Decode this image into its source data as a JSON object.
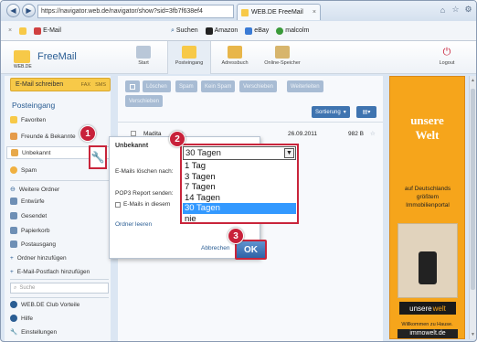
{
  "browser": {
    "url": "https://navigator.web.de/navigator/show?sid=3fb7f638ef4",
    "tab_title": "WEB.DE FreeMail",
    "toolbar": {
      "email_label": "E-Mail",
      "search_label": "Suchen",
      "amazon_label": "Amazon",
      "ebay_label": "eBay",
      "user_label": "malcolm"
    }
  },
  "app": {
    "brand": "WEB.DE",
    "product": "FreeMail",
    "nav": [
      "Start",
      "Posteingang",
      "Adressbuch",
      "Online-Speicher"
    ],
    "logout": "Logout"
  },
  "sidebar": {
    "compose": "E-Mail schreiben",
    "fax": "FAX",
    "sms": "SMS",
    "heading": "Posteingang",
    "items": [
      "Favoriten",
      "Freunde & Bekannte",
      "Unbekannt",
      "Spam",
      "Weitere Ordner",
      "Entwürfe",
      "Gesendet",
      "Papierkorb",
      "Postausgang",
      "Ordner hinzufügen",
      "E-Mail-Postfach hinzufügen"
    ],
    "search_placeholder": "Suche",
    "bottom": [
      "WEB.DE Club Vorteile",
      "Hilfe",
      "Einstellungen"
    ]
  },
  "main": {
    "toolbar": [
      "Löschen",
      "Spam",
      "Kein Spam",
      "Verschieben",
      "Weiterleiten"
    ],
    "toolbar_row2": "Verschieben",
    "sort": "Sortierung",
    "mail": {
      "sender": "Madita",
      "subject": "sie",
      "date": "26.09.2011",
      "size": "982 B"
    }
  },
  "dialog": {
    "title": "Unbekannt",
    "delete_label": "E-Mails löschen nach:",
    "pop3_label": "POP3 Report senden:",
    "checkbox_label": "E-Mails in diesem",
    "empty_link": "Ordner leeren",
    "cancel": "Abbrechen",
    "ok": "OK"
  },
  "dropdown": {
    "selected": "30 Tagen",
    "options": [
      "1 Tag",
      "3 Tagen",
      "7 Tagen",
      "14 Tagen",
      "30 Tagen",
      "nie"
    ],
    "highlighted_index": 4
  },
  "callouts": [
    "1",
    "2",
    "3"
  ],
  "ad": {
    "headline1": "unsere",
    "headline2": "Welt",
    "text": "auf Deutschlands größtem Immobilienportal",
    "logo1": "unsere",
    "logo2": "welt",
    "tagline": "Willkommen zu Hause.",
    "brand": "immowelt.de"
  },
  "colors": {
    "accent_red": "#c8213a",
    "brand_blue": "#2a5d93",
    "selected_option": "#3399ff",
    "ad_orange": "#f6a51b",
    "compose_yellow": "#f7c948"
  }
}
